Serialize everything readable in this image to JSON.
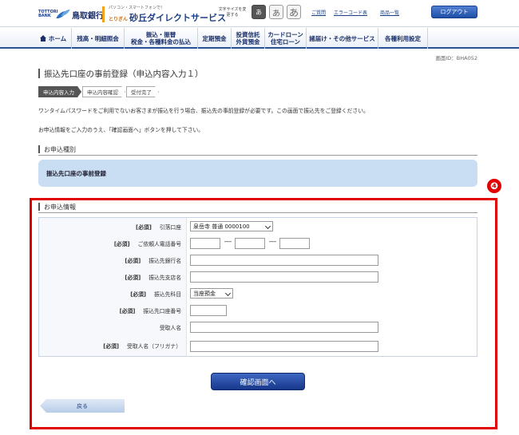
{
  "header": {
    "bank_logo_text": "TOTTORI BANK",
    "bank_name": "鳥取銀行",
    "service_sub": "パソコン・スマートフォンで！",
    "service_prefix": "とりぎん",
    "service_name": "砂丘ダイレクトサービス",
    "fontsize_label": "文字サイズを変更する",
    "fontsize_small": "あ",
    "fontsize_medium": "あ",
    "fontsize_large": "あ",
    "help_link": "ご質問",
    "error_code_link": "エラーコード表",
    "product_link": "商品一覧",
    "logout_label": "ログアウト"
  },
  "nav": {
    "items": [
      {
        "label": "ホーム"
      },
      {
        "label": "残高・明細照会"
      },
      {
        "label": "振込・振替\n税金・各種料金の払込"
      },
      {
        "label": "定期預金"
      },
      {
        "label": "投資信託\n外貨預金"
      },
      {
        "label": "カードローン\n住宅ローン"
      },
      {
        "label": "諸届け・その他サービス"
      },
      {
        "label": "各種利用設定"
      }
    ]
  },
  "screen_id": "画面ID：BHA052",
  "page_title": "振込先口座の事前登録（申込内容入力１）",
  "steps": [
    "申込内容入力",
    "申込内容確認",
    "受付完了"
  ],
  "description": {
    "line1": "ワンタイムパスワードをご利用でないお客さまが振込を行う場合、振込先の事前登録が必要です。この画面で振込先をご登録ください。",
    "line2": "お申込情報をご入力のうえ、「確認画面へ」ボタンを押して下さい。"
  },
  "sections": {
    "type_title": "お申込種別",
    "type_value": "振込先口座の事前登録",
    "info_title": "お申込情報",
    "badge": "❹"
  },
  "form": {
    "required_label": "[必須]",
    "fields": {
      "withdraw_account": {
        "label": "引落口座",
        "value": "泉岳寺 普通 0000100"
      },
      "phone": {
        "label": "ご依頼人電話番号",
        "separator": "―"
      },
      "bank_name": {
        "label": "振込先銀行名"
      },
      "branch_name": {
        "label": "振込先支店名"
      },
      "account_type": {
        "label": "振込先科目",
        "value": "当座預金"
      },
      "account_number": {
        "label": "振込先口座番号"
      },
      "recipient_name": {
        "label": "受取人名"
      },
      "recipient_kana": {
        "label": "受取人名（フリガナ）"
      }
    }
  },
  "buttons": {
    "confirm": "確認画面へ",
    "back": "戻る"
  },
  "colors": {
    "highlight_frame": "#e10000",
    "nav_accent": "#2b4f93",
    "info_box": "#c9ddf3"
  }
}
